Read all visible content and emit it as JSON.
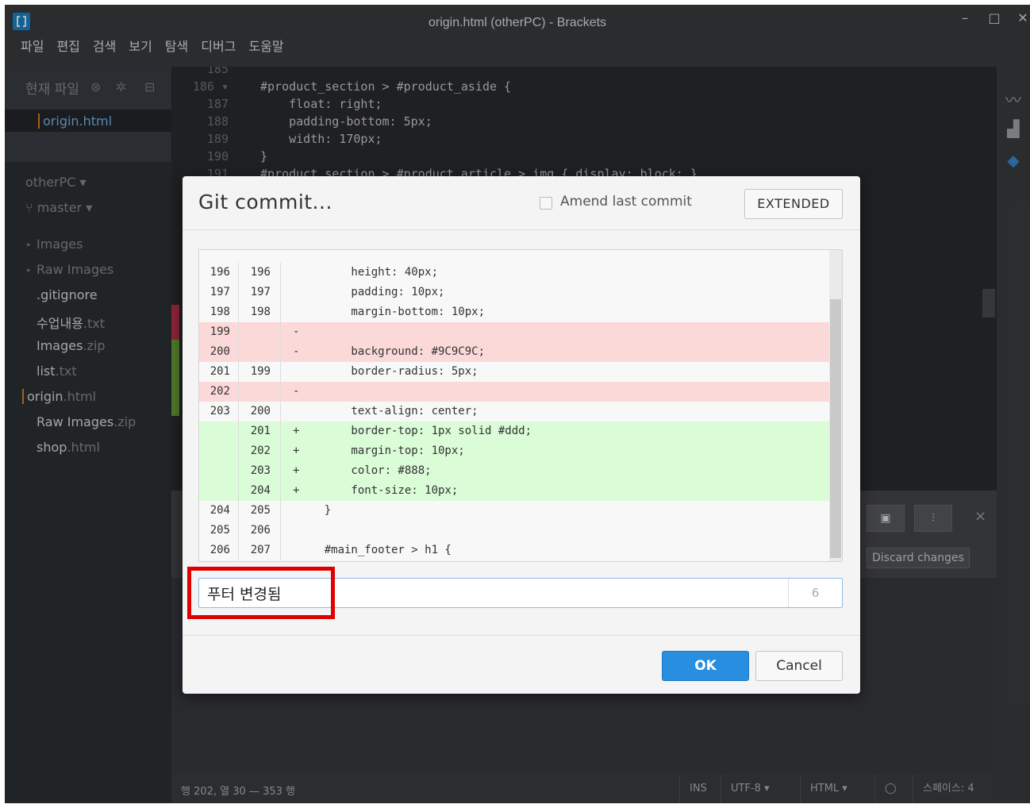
{
  "window": {
    "title": "origin.html (otherPC) - Brackets",
    "controls": {
      "minimize": "–",
      "maximize": "□",
      "close": "✕"
    }
  },
  "menu": [
    "파일",
    "편집",
    "검색",
    "보기",
    "탐색",
    "디버그",
    "도움말"
  ],
  "sidebar": {
    "working_title": "현재 파일",
    "working_file": "origin.html",
    "project": "otherPC ▾",
    "branch": "master ▾",
    "tree": [
      {
        "name": "Images",
        "ext": "",
        "folder": true
      },
      {
        "name": "Raw Images",
        "ext": "",
        "folder": true
      },
      {
        "name": ".gitignore",
        "ext": "",
        "folder": false
      },
      {
        "name": "수업내용",
        "ext": ".txt",
        "folder": false
      },
      {
        "name": "Images",
        "ext": ".zip",
        "folder": false
      },
      {
        "name": "list",
        "ext": ".txt",
        "folder": false
      },
      {
        "name": "origin",
        "ext": ".html",
        "folder": false
      },
      {
        "name": "Raw Images",
        "ext": ".zip",
        "folder": false
      },
      {
        "name": "shop",
        "ext": ".html",
        "folder": false
      }
    ]
  },
  "editor": {
    "lines": [
      {
        "n": "185",
        "text": ""
      },
      {
        "n": "186 ▾",
        "text": "#product_section > #product_aside {"
      },
      {
        "n": "187",
        "text": "    float: right;"
      },
      {
        "n": "188",
        "text": "    padding-bottom: 5px;"
      },
      {
        "n": "189",
        "text": "    width: 170px;"
      },
      {
        "n": "190",
        "text": "}"
      },
      {
        "n": "191",
        "text": "#product_section > #product_article > img { display: block; }"
      }
    ]
  },
  "git_panel": {
    "discard_label": "Discard changes",
    "terminal_icon": "terminal-icon",
    "settings_icon": "sliders-icon",
    "close": "×"
  },
  "statusbar": {
    "cursor": "행 202, 열 30 — 353 행",
    "mode": "INS",
    "encoding": "UTF-8 ▾",
    "language": "HTML ▾",
    "spaces": "스페이스: 4"
  },
  "dialog": {
    "title": "Git commit...",
    "amend_label": "Amend last commit",
    "extended_label": "EXTENDED",
    "diff_rows": [
      {
        "old": "196",
        "new": "196",
        "mark": "",
        "code": "        height: 40px;",
        "type": "ctx"
      },
      {
        "old": "197",
        "new": "197",
        "mark": "",
        "code": "        padding: 10px;",
        "type": "ctx"
      },
      {
        "old": "198",
        "new": "198",
        "mark": "",
        "code": "        margin-bottom: 10px;",
        "type": "ctx"
      },
      {
        "old": "199",
        "new": "",
        "mark": "-",
        "code": "",
        "type": "del"
      },
      {
        "old": "200",
        "new": "",
        "mark": "-",
        "code": "        background: #9C9C9C;",
        "type": "del"
      },
      {
        "old": "201",
        "new": "199",
        "mark": "",
        "code": "        border-radius: 5px;",
        "type": "ctx"
      },
      {
        "old": "202",
        "new": "",
        "mark": "-",
        "code": "",
        "type": "del"
      },
      {
        "old": "203",
        "new": "200",
        "mark": "",
        "code": "        text-align: center;",
        "type": "ctx"
      },
      {
        "old": "",
        "new": "201",
        "mark": "+",
        "code": "        border-top: 1px solid #ddd;",
        "type": "add"
      },
      {
        "old": "",
        "new": "202",
        "mark": "+",
        "code": "        margin-top: 10px;",
        "type": "add"
      },
      {
        "old": "",
        "new": "203",
        "mark": "+",
        "code": "        color: #888;",
        "type": "add"
      },
      {
        "old": "",
        "new": "204",
        "mark": "+",
        "code": "        font-size: 10px;",
        "type": "add"
      },
      {
        "old": "204",
        "new": "205",
        "mark": "",
        "code": "    }",
        "type": "ctx"
      },
      {
        "old": "205",
        "new": "206",
        "mark": "",
        "code": "",
        "type": "ctx"
      },
      {
        "old": "206",
        "new": "207",
        "mark": "",
        "code": "    #main_footer > h1 {",
        "type": "ctx"
      }
    ],
    "message_value": "푸터 변경됨",
    "message_count": "6",
    "ok_label": "OK",
    "cancel_label": "Cancel"
  },
  "colors": {
    "accent": "#288edf",
    "diff_deleted": "#fcd9d9",
    "diff_added": "#dafcd7",
    "highlight": "#e00000"
  }
}
